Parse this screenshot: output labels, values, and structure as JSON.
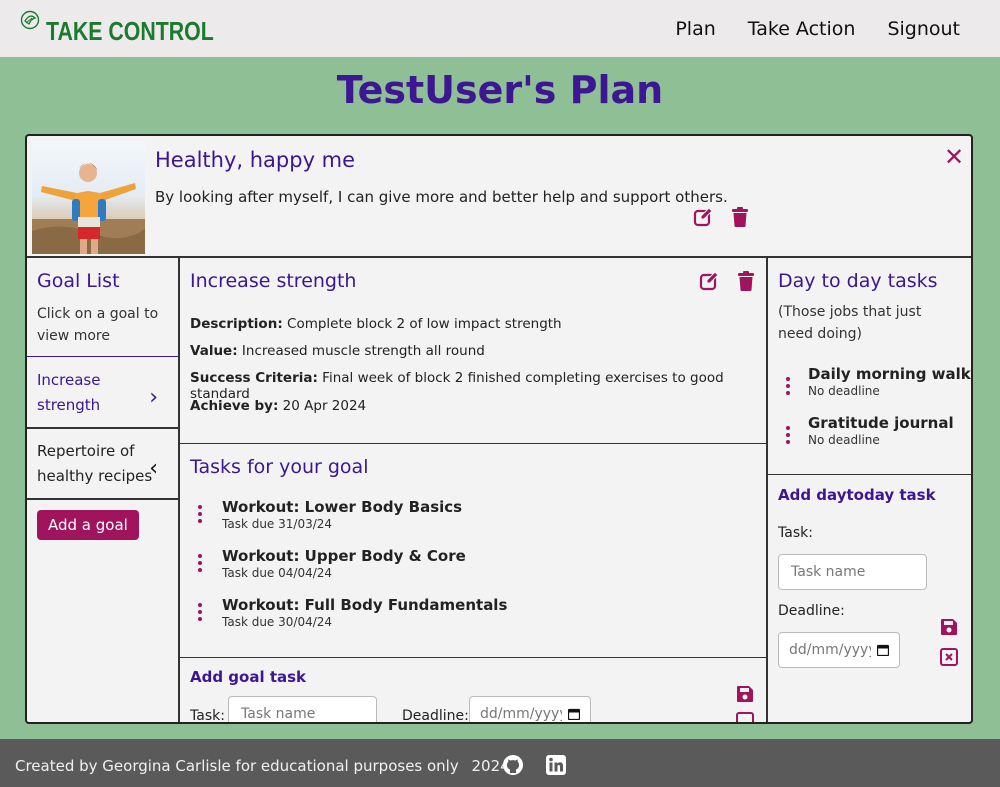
{
  "header": {
    "brand": "TAKE CONTROL",
    "nav": [
      "Plan",
      "Take Action",
      "Signout"
    ]
  },
  "page_title": "TestUser's Plan",
  "plan": {
    "title": "Healthy, happy me",
    "description": "By looking after myself, I can give more and better help and support others.",
    "close_icon": "✕"
  },
  "goal_list": {
    "title": "Goal List",
    "hint": "Click on a goal to view more",
    "items": [
      {
        "label_line1": "Increase",
        "label_line2": "strength",
        "chevron": "›"
      },
      {
        "label_line1": "Repertoire of",
        "label_line2": "healthy recipes",
        "chevron": "‹"
      }
    ],
    "add_button": "Add a goal"
  },
  "goal": {
    "title": "Increase strength",
    "description_label": "Description:",
    "description": "Complete block 2 of low impact strength",
    "value_label": "Value:",
    "value": "Increased muscle strength all round",
    "success_label": "Success Criteria:",
    "success": "Final week of block 2 finished completing exercises to good standard",
    "achieve_label": "Achieve by:",
    "achieve": "20 Apr 2024"
  },
  "goal_tasks": {
    "title": "Tasks for your goal",
    "items": [
      {
        "title": "Workout: Lower Body Basics",
        "due": "Task due 31/03/24"
      },
      {
        "title": "Workout: Upper Body & Core",
        "due": "Task due 04/04/24"
      },
      {
        "title": "Workout: Full Body Fundamentals",
        "due": "Task due 30/04/24"
      }
    ],
    "add_title": "Add goal task",
    "task_label": "Task:",
    "task_placeholder": "Task name",
    "deadline_label": "Deadline:",
    "deadline_placeholder": "dd/mm/yyyy"
  },
  "daily": {
    "title": "Day to day tasks",
    "hint": "(Those jobs that just need doing)",
    "items": [
      {
        "title": "Daily morning walk",
        "sub": "No deadline"
      },
      {
        "title": "Gratitude journal",
        "sub": "No deadline"
      }
    ],
    "add_title": "Add daytoday task",
    "task_label": "Task:",
    "task_placeholder": "Task name",
    "deadline_label": "Deadline:",
    "deadline_placeholder": "dd/mm/yyyy"
  },
  "footer": {
    "text": "Created by Georgina Carlisle for educational purposes only",
    "year": "2024"
  },
  "colors": {
    "background": "#8fbf94",
    "brand_green": "#1b7a2e",
    "heading_purple": "#3d1693",
    "accent": "#a0145e",
    "footer": "#5a5a5a"
  },
  "icons": [
    "leaf-logo-icon",
    "edit-icon",
    "trash-icon",
    "close-icon",
    "chevron-right-icon",
    "chevron-left-icon",
    "kebab-menu-icon",
    "save-icon",
    "cancel-icon",
    "calendar-icon",
    "github-icon",
    "linkedin-icon"
  ]
}
